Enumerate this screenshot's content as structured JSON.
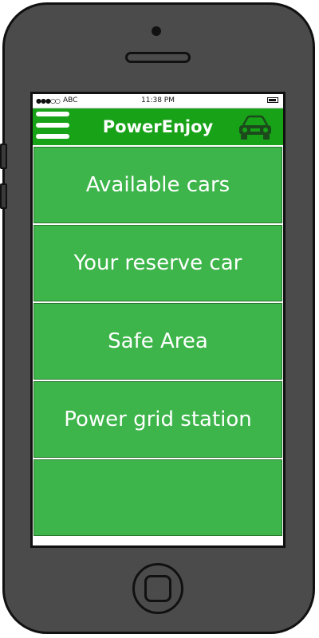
{
  "status_bar": {
    "signal": "●●●○○",
    "carrier": "ABC",
    "time": "11:38 PM",
    "battery_icon": "battery-icon"
  },
  "header": {
    "title": "PowerEnjoy",
    "background_color": "#17a217",
    "menu_icon": "hamburger-menu-icon",
    "car_icon": "car-icon"
  },
  "menu": {
    "items": [
      {
        "label": "Available cars"
      },
      {
        "label": "Your reserve car"
      },
      {
        "label": "Safe Area"
      },
      {
        "label": "Power grid station"
      },
      {
        "label": ""
      }
    ],
    "item_color": "#3db54a"
  }
}
